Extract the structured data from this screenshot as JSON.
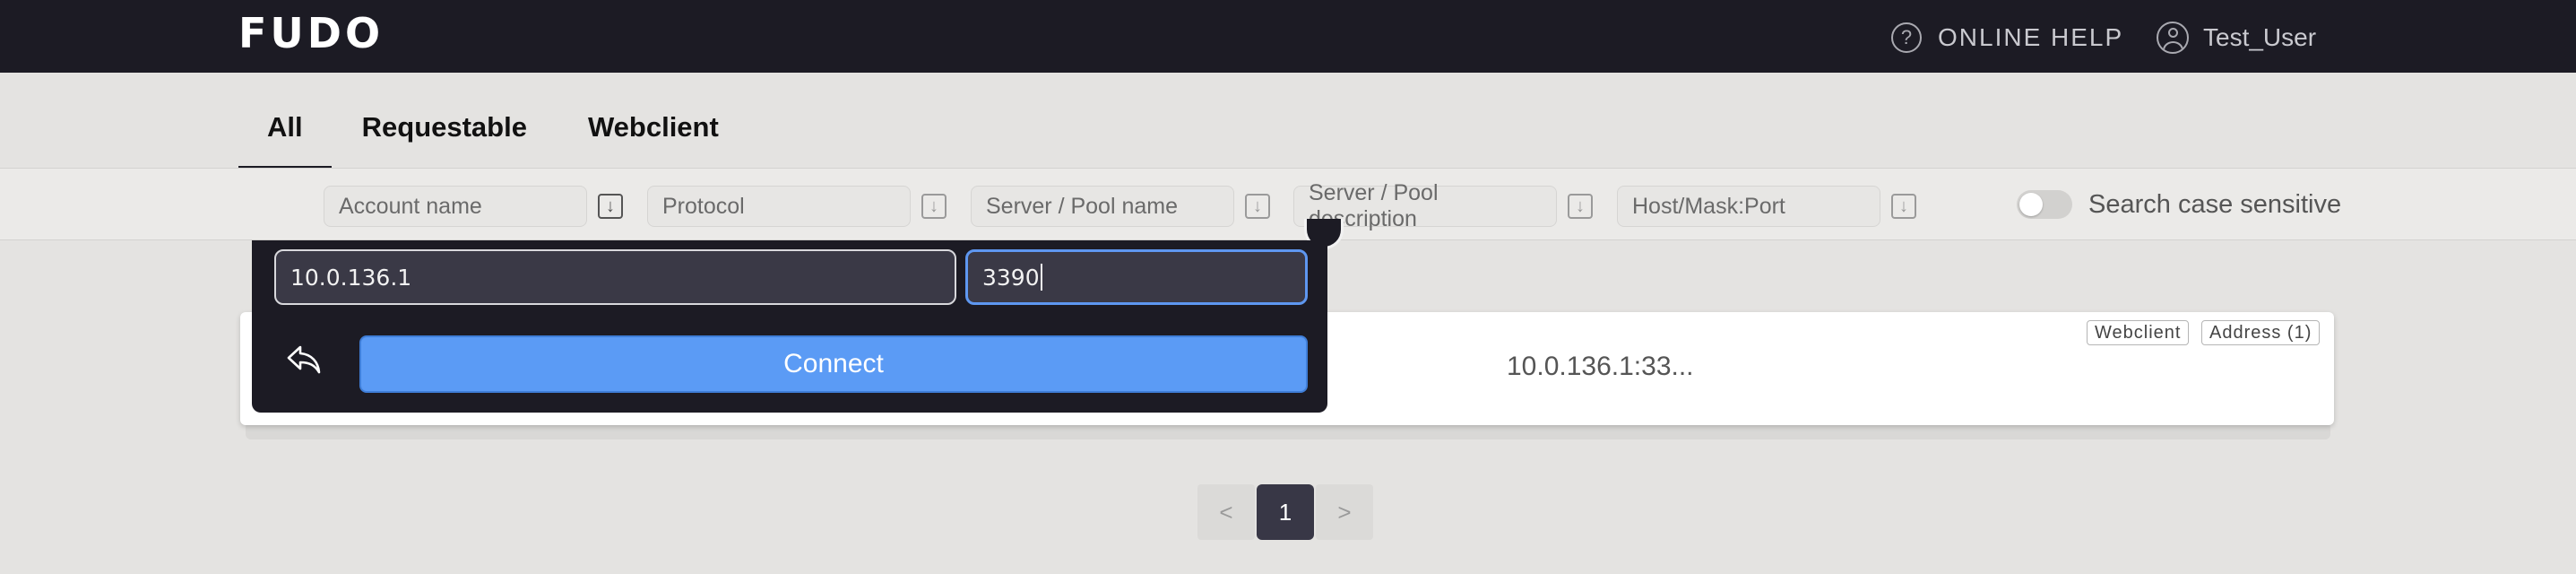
{
  "header": {
    "logo": "FUDO",
    "help_label": "ONLINE HELP",
    "user_name": "Test_User"
  },
  "tabs": [
    {
      "label": "All",
      "active": true
    },
    {
      "label": "Requestable",
      "active": false
    },
    {
      "label": "Webclient",
      "active": false
    }
  ],
  "filters": {
    "account_name": "Account name",
    "protocol": "Protocol",
    "server_pool_name": "Server / Pool name",
    "server_pool_description": "Server / Pool description",
    "host_mask_port": "Host/Mask:Port",
    "case_sensitive_label": "Search case sensitive",
    "case_sensitive_on": false
  },
  "connect_popup": {
    "host_value": "10.0.136.1",
    "port_value": "3390",
    "connect_label": "Connect"
  },
  "result_card": {
    "address": "10.0.136.1:33...",
    "badges": [
      "Webclient",
      "Address (1)"
    ]
  },
  "pagination": {
    "prev": "<",
    "current": "1",
    "next": ">"
  },
  "colors": {
    "topbar": "#1c1b24",
    "accent": "#5b9bf5",
    "page_current": "#383746"
  }
}
